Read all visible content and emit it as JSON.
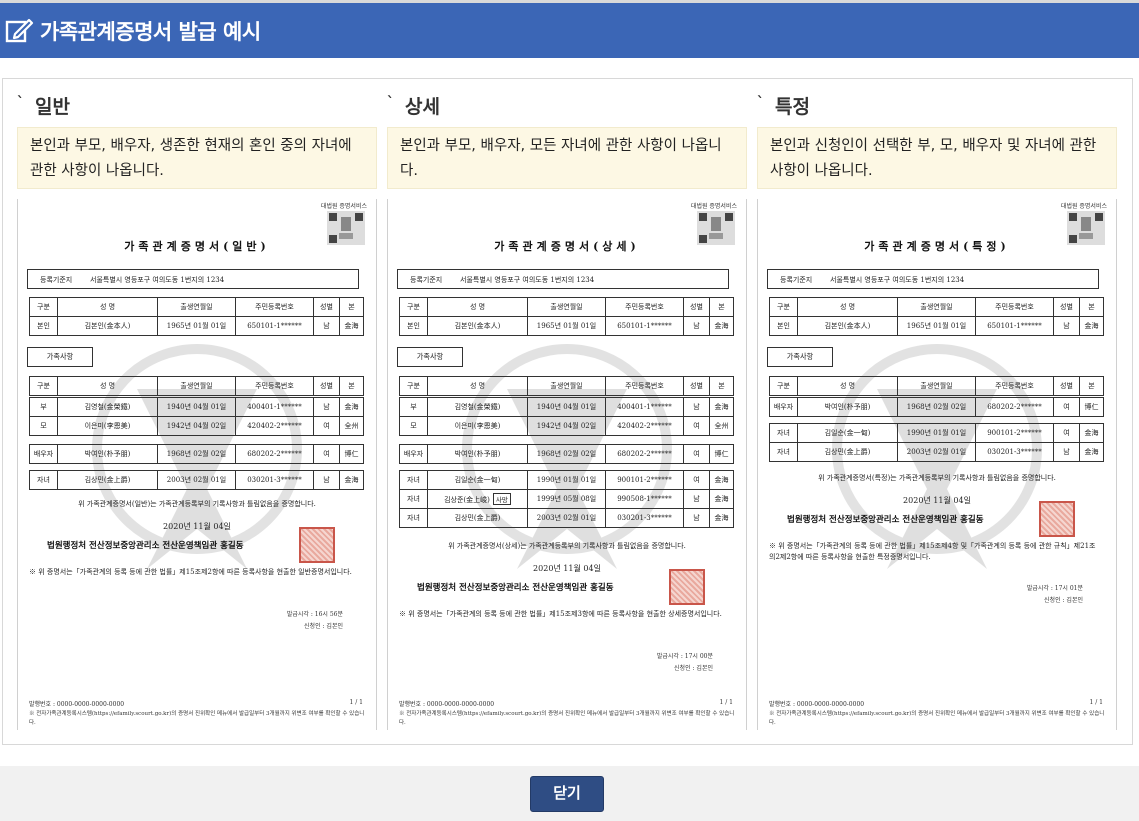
{
  "header": {
    "title": "가족관계증명서 발급 예시",
    "icon": "edit-icon"
  },
  "columns": [
    {
      "title": "일반",
      "desc": "본인과 부모, 배우자, 생존한 현재의 혼인 중의 자녀에 관한 사항이 나옵니다.",
      "doc": {
        "gov_label": "대법원 증명서비스",
        "title": "가족관계증명서(일반)",
        "reg_label": "등록기준지",
        "reg_value": "서울특별시 영등포구 여의도동 1번지의 1234",
        "headers": [
          "구분",
          "성  명",
          "출생연월일",
          "주민등록번호",
          "성별",
          "본"
        ],
        "self": [
          "본인",
          "김본인(金本人)",
          "1965년 01월 01일",
          "650101-1******",
          "남",
          "金海"
        ],
        "family_label": "가족사항",
        "groups": [
          [
            [
              "부",
              "김영철(金榮鐵)",
              "1940년 04월 01일",
              "400401-1******",
              "남",
              "金海"
            ],
            [
              "모",
              "이은미(李恩美)",
              "1942년 04월 02일",
              "420402-2******",
              "여",
              "全州"
            ]
          ],
          [
            [
              "배우자",
              "박여인(朴予朋)",
              "1968년 02월 02일",
              "680202-2******",
              "여",
              "博仁"
            ]
          ],
          [
            [
              "자녀",
              "김상민(金上爵)",
              "2003년 02월 01일",
              "030201-3******",
              "남",
              "金海"
            ]
          ]
        ],
        "statement": "위 가족관계증명서(일반)는 가족관계등록부의 기록사항과 틀림없음을 증명합니다.",
        "date": "2020년 11월 04일",
        "issuer": "법원행정처 전산정보중앙관리소 전산운영책임관 홍길동",
        "note": "※ 위 증명서는「가족관계의 등록 등에 관한 법률」제15조제2항에 따른 등록사항을 현출한 일반증명서입니다.",
        "time": "발급시각 : 16시 56분",
        "applicant": "신청인 : 김본인",
        "issue_no": "발행번호 : 0000-0000-0000-0000",
        "page": "1 / 1",
        "footnote": "※ 전자가족관계등록시스템(https://efamily.scourt.go.kr)의 증명서 진위확인 메뉴에서 발급일부터 3개월까지 위변조 여부를 확인할 수 있습니다."
      }
    },
    {
      "title": "상세",
      "desc": "본인과 부모, 배우자, 모든 자녀에 관한 사항이 나옵니다.",
      "doc": {
        "gov_label": "대법원 증명서비스",
        "title": "가족관계증명서(상세)",
        "reg_label": "등록기준지",
        "reg_value": "서울특별시 영등포구 여의도동 1번지의 1234",
        "headers": [
          "구분",
          "성  명",
          "출생연월일",
          "주민등록번호",
          "성별",
          "본"
        ],
        "self": [
          "본인",
          "김본인(金本人)",
          "1965년 01월 01일",
          "650101-1******",
          "남",
          "金海"
        ],
        "family_label": "가족사항",
        "groups": [
          [
            [
              "부",
              "김영철(金榮鐵)",
              "1940년 04월 01일",
              "400401-1******",
              "남",
              "金海"
            ],
            [
              "모",
              "이은미(李恩美)",
              "1942년 04월 02일",
              "420402-2******",
              "여",
              "全州"
            ]
          ],
          [
            [
              "배우자",
              "박여인(朴予朋)",
              "1968년 02월 02일",
              "680202-2******",
              "여",
              "博仁"
            ]
          ],
          [
            [
              "자녀",
              "김일순(金一甸)",
              "1990년 01월 01일",
              "900101-2******",
              "여",
              "金海"
            ],
            [
              "자녀",
              "김상준(金上峻)",
              "1999년 05월 08일",
              "990508-1******",
              "남",
              "金海"
            ],
            [
              "자녀",
              "김상민(金上爵)",
              "2003년 02월 01일",
              "030201-3******",
              "남",
              "金海"
            ]
          ]
        ],
        "deceased_tag": "사망",
        "statement": "위 가족관계증명서(상세)는 가족관계등록부의 기록사항과 틀림없음을 증명합니다.",
        "date": "2020년 11월 04일",
        "issuer": "법원행정처 전산정보중앙관리소 전산운영책임관 홍길동",
        "note": "※ 위 증명서는「가족관계의 등록 등에 관한 법률」제15조제3항에 따른 등록사항을 현출한 상세증명서입니다.",
        "time": "발급시각 : 17시 00분",
        "applicant": "신청인 : 김본인",
        "issue_no": "발행번호 : 0000-0000-0000-0000",
        "page": "1 / 1",
        "footnote": "※ 전자가족관계등록시스템(https://efamily.scourt.go.kr)의 증명서 진위확인 메뉴에서 발급일부터 3개월까지 위변조 여부를 확인할 수 있습니다."
      }
    },
    {
      "title": "특정",
      "desc": "본인과 신청인이 선택한 부, 모, 배우자 및 자녀에 관한 사항이 나옵니다.",
      "doc": {
        "gov_label": "대법원 증명서비스",
        "title": "가족관계증명서(특정)",
        "reg_label": "등록기준지",
        "reg_value": "서울특별시 영등포구 여의도동 1번지의 1234",
        "headers": [
          "구분",
          "성  명",
          "출생연월일",
          "주민등록번호",
          "성별",
          "본"
        ],
        "self": [
          "본인",
          "김본인(金本人)",
          "1965년 01월 01일",
          "650101-1******",
          "남",
          "金海"
        ],
        "family_label": "가족사항",
        "groups": [
          [
            [
              "배우자",
              "박여인(朴予朋)",
              "1968년 02월 02일",
              "680202-2******",
              "여",
              "博仁"
            ]
          ],
          [
            [
              "자녀",
              "김일순(金一甸)",
              "1990년 01월 01일",
              "900101-2******",
              "여",
              "金海"
            ],
            [
              "자녀",
              "김상민(金上爵)",
              "2003년 02월 01일",
              "030201-3******",
              "남",
              "金海"
            ]
          ]
        ],
        "statement": "위 가족관계증명서(특정)는 가족관계등록부의 기록사항과 틀림없음을 증명합니다.",
        "date": "2020년 11월 04일",
        "issuer": "법원행정처 전산정보중앙관리소 전산운영책임관 홍길동",
        "note": "※ 위 증명서는「가족관계의 등록 등에 관한 법률」제15조제4항 및「가족관계의 등록 등에 관한 규칙」제21조의2제2항에 따른 등록사항을 현출한 특정증명서입니다.",
        "time": "발급시각 : 17시 01분",
        "applicant": "신청인 : 김본인",
        "issue_no": "발행번호 : 0000-0000-0000-0000",
        "page": "1 / 1",
        "footnote": "※ 전자가족관계등록시스템(https://efamily.scourt.go.kr)의 증명서 진위확인 메뉴에서 발급일부터 3개월까지 위변조 여부를 확인할 수 있습니다."
      }
    }
  ],
  "footer": {
    "close_label": "닫기"
  }
}
